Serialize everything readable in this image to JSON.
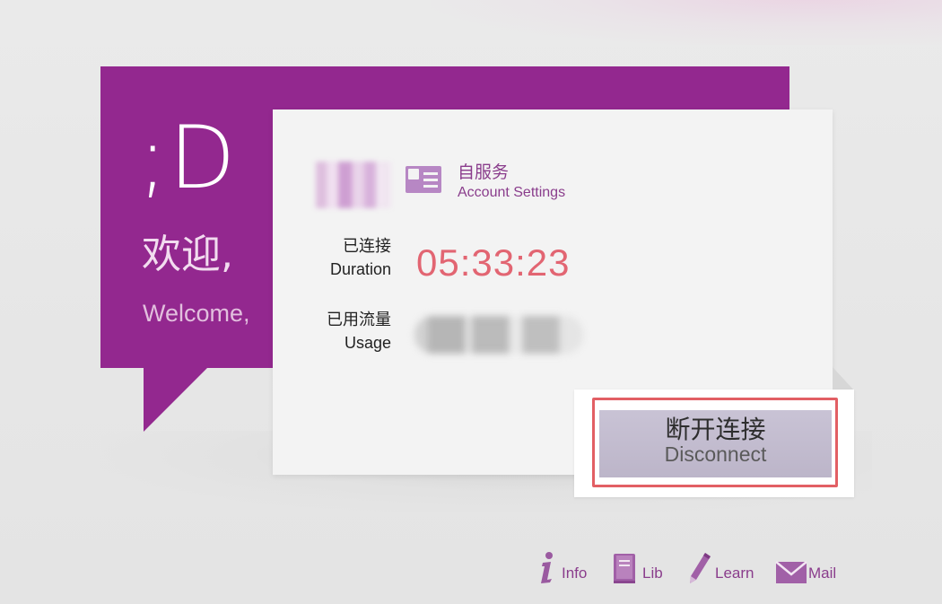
{
  "welcome": {
    "smiley": ";D",
    "title_cn": "欢迎,",
    "title_en": "Welcome,"
  },
  "account": {
    "label_cn": "自服务",
    "label_en": "Account Settings",
    "icon": "account-card-icon"
  },
  "stats": {
    "duration": {
      "label_cn": "已连接",
      "label_en": "Duration",
      "value": "05:33:23"
    },
    "usage": {
      "label_cn": "已用流量",
      "label_en": "Usage"
    }
  },
  "disconnect": {
    "label_cn": "断开连接",
    "label_en": "Disconnect"
  },
  "footer": {
    "links": [
      {
        "label": "Info",
        "icon": "info-icon"
      },
      {
        "label": "Lib",
        "icon": "book-icon"
      },
      {
        "label": "Learn",
        "icon": "pencil-icon"
      },
      {
        "label": "Mail",
        "icon": "mail-icon"
      }
    ]
  },
  "colors": {
    "brand_purple": "#93288f",
    "link_purple": "#8a3d8c",
    "duration_red": "#e26572",
    "highlight_red": "#e25f64",
    "button_gray": "#c4bed0"
  }
}
